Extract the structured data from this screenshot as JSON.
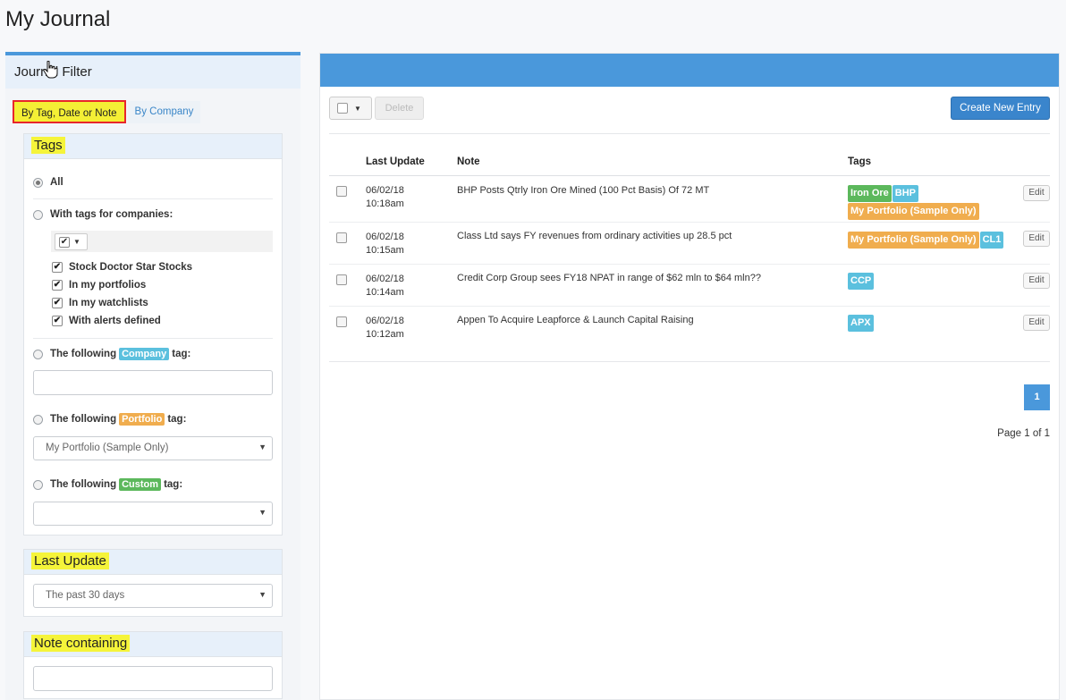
{
  "page": {
    "title": "My Journal"
  },
  "filter": {
    "header": "Journal Filter",
    "tabs": [
      {
        "label": "By Tag, Date or Note",
        "active": true
      },
      {
        "label": "By Company",
        "active": false
      }
    ],
    "tags_section": {
      "heading": "Tags",
      "all_label": "All",
      "companies_label": "With tags for companies:",
      "checkbox_options": [
        {
          "label": "Stock Doctor Star Stocks",
          "checked": true
        },
        {
          "label": "In my portfolios",
          "checked": true
        },
        {
          "label": "In my watchlists",
          "checked": true
        },
        {
          "label": "With alerts defined",
          "checked": true
        }
      ],
      "company_tag": {
        "prefix": "The following",
        "badge": "Company",
        "suffix": "tag:",
        "value": ""
      },
      "portfolio_tag": {
        "prefix": "The following",
        "badge": "Portfolio",
        "suffix": "tag:",
        "selected": "My Portfolio (Sample Only)"
      },
      "custom_tag": {
        "prefix": "The following",
        "badge": "Custom",
        "suffix": "tag:",
        "selected": ""
      }
    },
    "last_update": {
      "heading": "Last Update",
      "selected": "The past 30 days"
    },
    "note_containing": {
      "heading": "Note containing",
      "value": ""
    }
  },
  "toolbar": {
    "delete_label": "Delete",
    "create_label": "Create New Entry"
  },
  "table": {
    "headers": {
      "last_update": "Last Update",
      "note": "Note",
      "tags": "Tags"
    },
    "rows": [
      {
        "date": "06/02/18",
        "time": "10:18am",
        "note": "BHP Posts Qtrly Iron Ore Mined (100 Pct Basis) Of 72 MT",
        "tags": [
          {
            "text": "Iron Ore",
            "color": "#5cb85c"
          },
          {
            "text": "BHP",
            "color": "#5bc0de"
          },
          {
            "text": "My Portfolio (Sample Only)",
            "color": "#f0ad4e"
          }
        ],
        "edit_label": "Edit"
      },
      {
        "date": "06/02/18",
        "time": "10:15am",
        "note": "Class Ltd says FY revenues from ordinary activities up 28.5 pct",
        "tags": [
          {
            "text": "My Portfolio (Sample Only)",
            "color": "#f0ad4e"
          },
          {
            "text": "CL1",
            "color": "#5bc0de"
          }
        ],
        "edit_label": "Edit"
      },
      {
        "date": "06/02/18",
        "time": "10:14am",
        "note": "Credit Corp Group sees FY18 NPAT in range of $62 mln to $64 mln??",
        "tags": [
          {
            "text": "CCP",
            "color": "#5bc0de"
          }
        ],
        "edit_label": "Edit"
      },
      {
        "date": "06/02/18",
        "time": "10:12am",
        "note": "Appen To Acquire Leapforce & Launch Capital Raising",
        "tags": [
          {
            "text": "APX",
            "color": "#5bc0de"
          }
        ],
        "edit_label": "Edit"
      }
    ]
  },
  "pagination": {
    "current_page": "1",
    "info": "Page 1 of 1"
  }
}
